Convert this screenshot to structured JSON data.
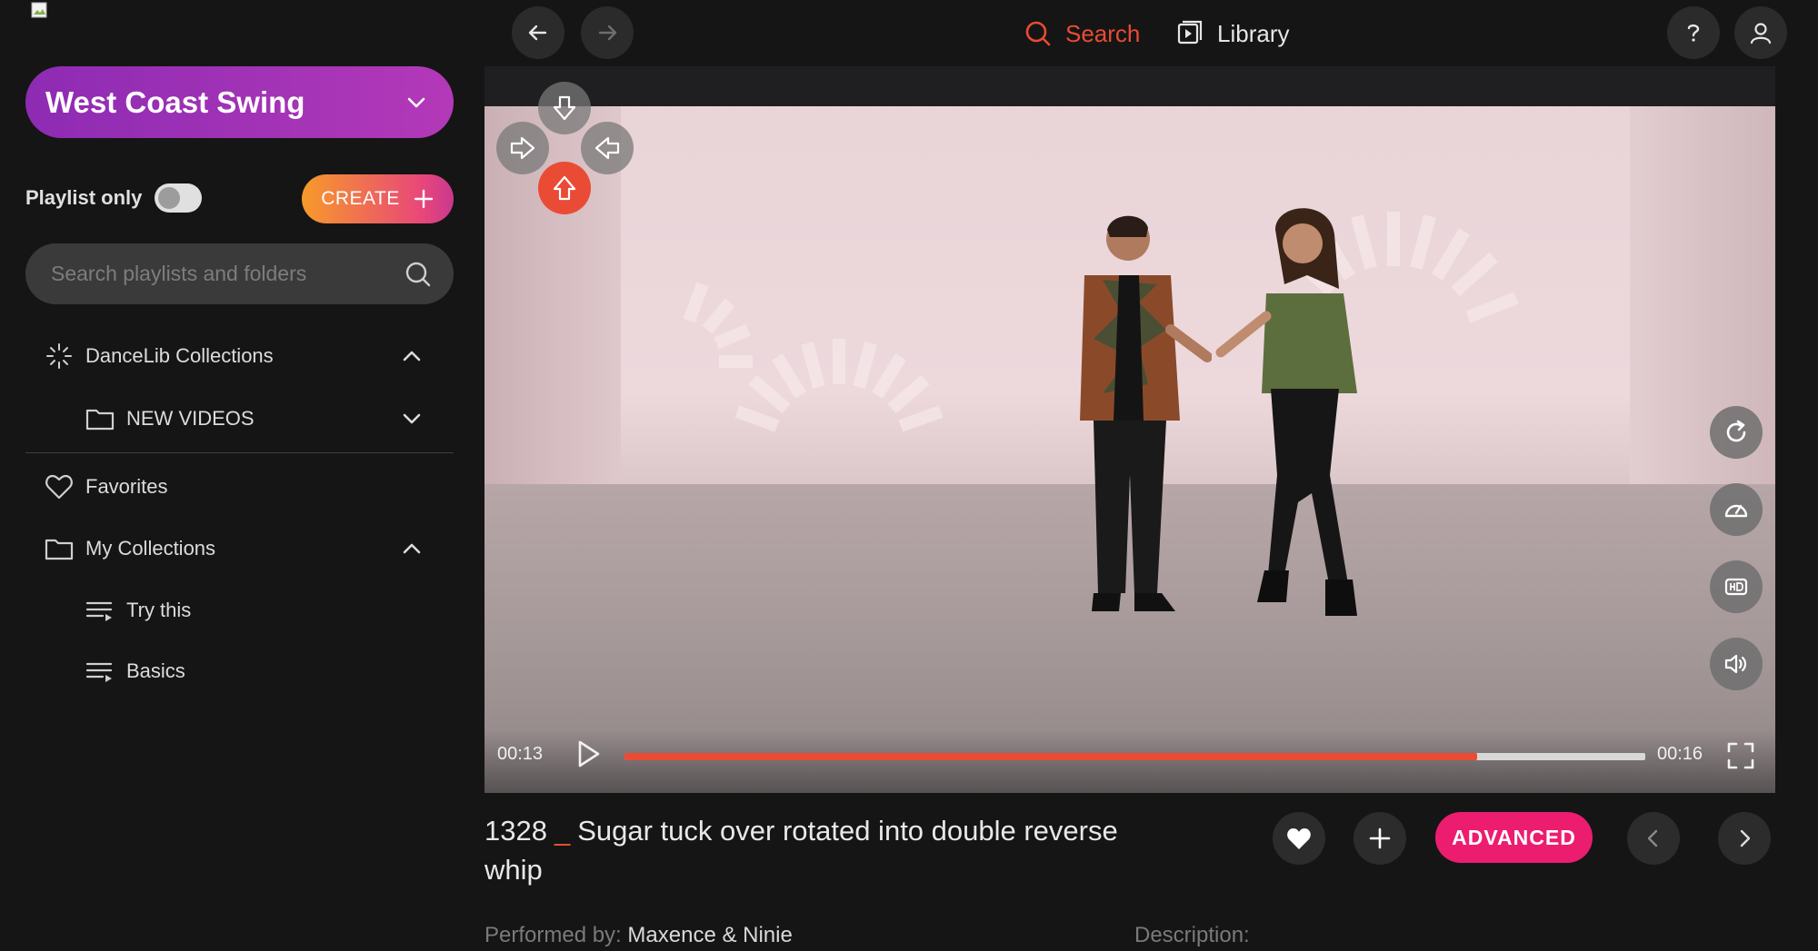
{
  "topbar": {
    "search_label": "Search",
    "library_label": "Library",
    "accent_color": "#ea4b35"
  },
  "sidebar": {
    "dance_style": "West Coast Swing",
    "playlist_only_label": "Playlist only",
    "playlist_only_on": false,
    "create_label": "CREATE",
    "search_placeholder": "Search playlists and folders",
    "items": [
      {
        "label": "DanceLib Collections",
        "icon": "sparkle-icon",
        "expanded": true
      },
      {
        "label": "NEW VIDEOS",
        "icon": "folder-icon",
        "expanded": false
      },
      {
        "label": "Favorites",
        "icon": "heart-icon"
      },
      {
        "label": "My Collections",
        "icon": "folder-icon",
        "expanded": true
      },
      {
        "label": "Try this",
        "icon": "playlist-icon"
      },
      {
        "label": "Basics",
        "icon": "playlist-icon"
      }
    ]
  },
  "player": {
    "current_time": "00:13",
    "duration": "00:16",
    "progress": 0.835,
    "overlay_controls": [
      "arrow-down-icon",
      "arrow-right-icon",
      "arrow-left-icon",
      "arrow-up-icon"
    ],
    "side_controls": [
      "replay-icon",
      "speed-icon",
      "hd-icon",
      "volume-icon"
    ]
  },
  "video": {
    "number": "1328",
    "separator": "_",
    "title": "Sugar tuck over rotated into double reverse whip",
    "level": "ADVANCED",
    "performed_by_label": "Performed by:",
    "performed_by": "Maxence & Ninie",
    "description_label": "Description:"
  }
}
